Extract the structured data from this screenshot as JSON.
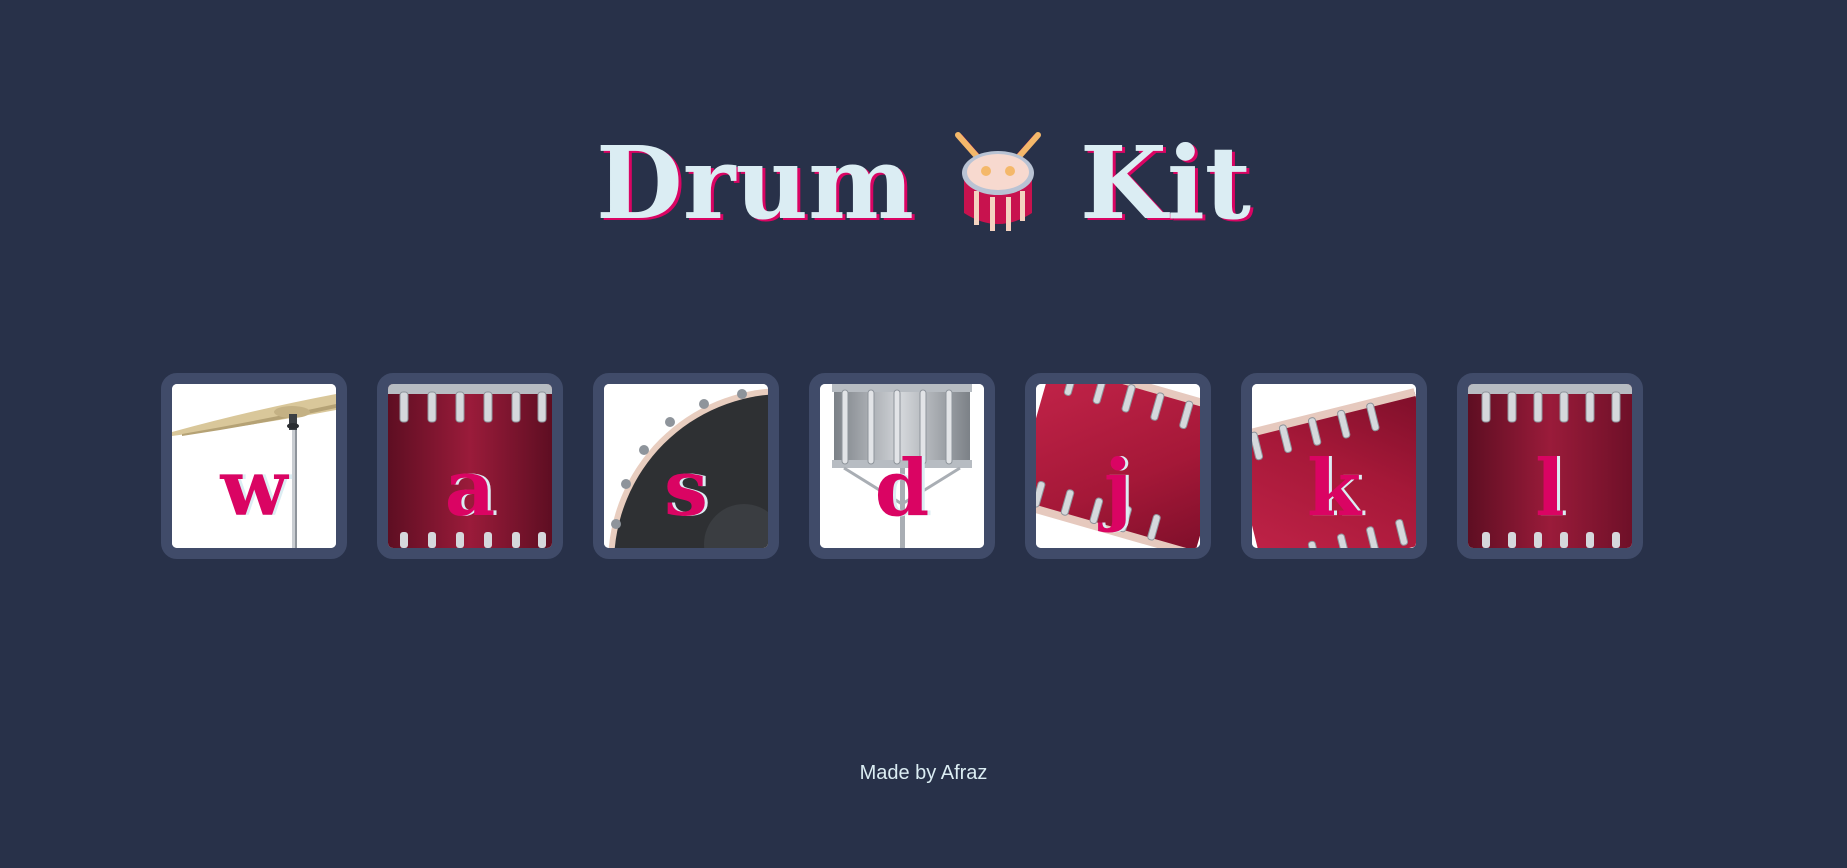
{
  "header": {
    "title_left": "Drum",
    "title_icon": "drum-emoji-icon",
    "title_right": "Kit"
  },
  "drums": [
    {
      "key": "w",
      "icon": "crash-cymbal-icon"
    },
    {
      "key": "a",
      "icon": "kick-drum-icon"
    },
    {
      "key": "s",
      "icon": "bass-drum-icon"
    },
    {
      "key": "d",
      "icon": "snare-drum-icon"
    },
    {
      "key": "j",
      "icon": "tom-1-icon"
    },
    {
      "key": "k",
      "icon": "tom-2-icon"
    },
    {
      "key": "l",
      "icon": "tom-3-icon"
    }
  ],
  "footer": {
    "text": "Made by Afraz"
  },
  "colors": {
    "background": "#283149",
    "button_border": "#404B69",
    "accent": "#DA0463",
    "text_light": "#DBEDF3"
  }
}
